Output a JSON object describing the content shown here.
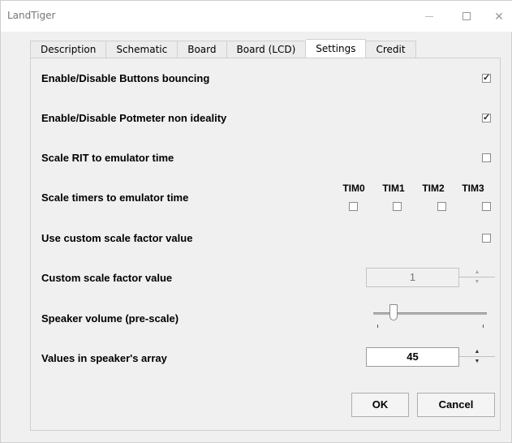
{
  "window": {
    "title": "LandTiger",
    "minimize_glyph": "—",
    "maximize_glyph": "☐",
    "close_glyph": "✕"
  },
  "tabs": [
    {
      "label": "Description",
      "active": false
    },
    {
      "label": "Schematic",
      "active": false
    },
    {
      "label": "Board",
      "active": false
    },
    {
      "label": "Board (LCD)",
      "active": false
    },
    {
      "label": "Settings",
      "active": true
    },
    {
      "label": "Credit",
      "active": false
    }
  ],
  "settings": {
    "buttons_bouncing": {
      "label": "Enable/Disable Buttons bouncing",
      "checked": true
    },
    "potmeter": {
      "label": "Enable/Disable Potmeter non ideality",
      "checked": true
    },
    "scale_rit": {
      "label": "Scale RIT to emulator time",
      "checked": false
    },
    "scale_timers": {
      "label": "Scale timers to emulator time",
      "timers": [
        {
          "label": "TIM0",
          "checked": false
        },
        {
          "label": "TIM1",
          "checked": false
        },
        {
          "label": "TIM2",
          "checked": false
        },
        {
          "label": "TIM3",
          "checked": false
        }
      ]
    },
    "custom_scale": {
      "label": "Use custom scale factor value",
      "checked": false
    },
    "custom_scale_value": {
      "label": "Custom scale factor value",
      "value": "1",
      "enabled": false
    },
    "speaker_volume": {
      "label": "Speaker volume (pre-scale)",
      "level": 0.15
    },
    "speaker_array": {
      "label": "Values in speaker's array",
      "value": "45",
      "enabled": true
    }
  },
  "buttons": {
    "ok": "OK",
    "cancel": "Cancel"
  },
  "check_glyph": "✓"
}
